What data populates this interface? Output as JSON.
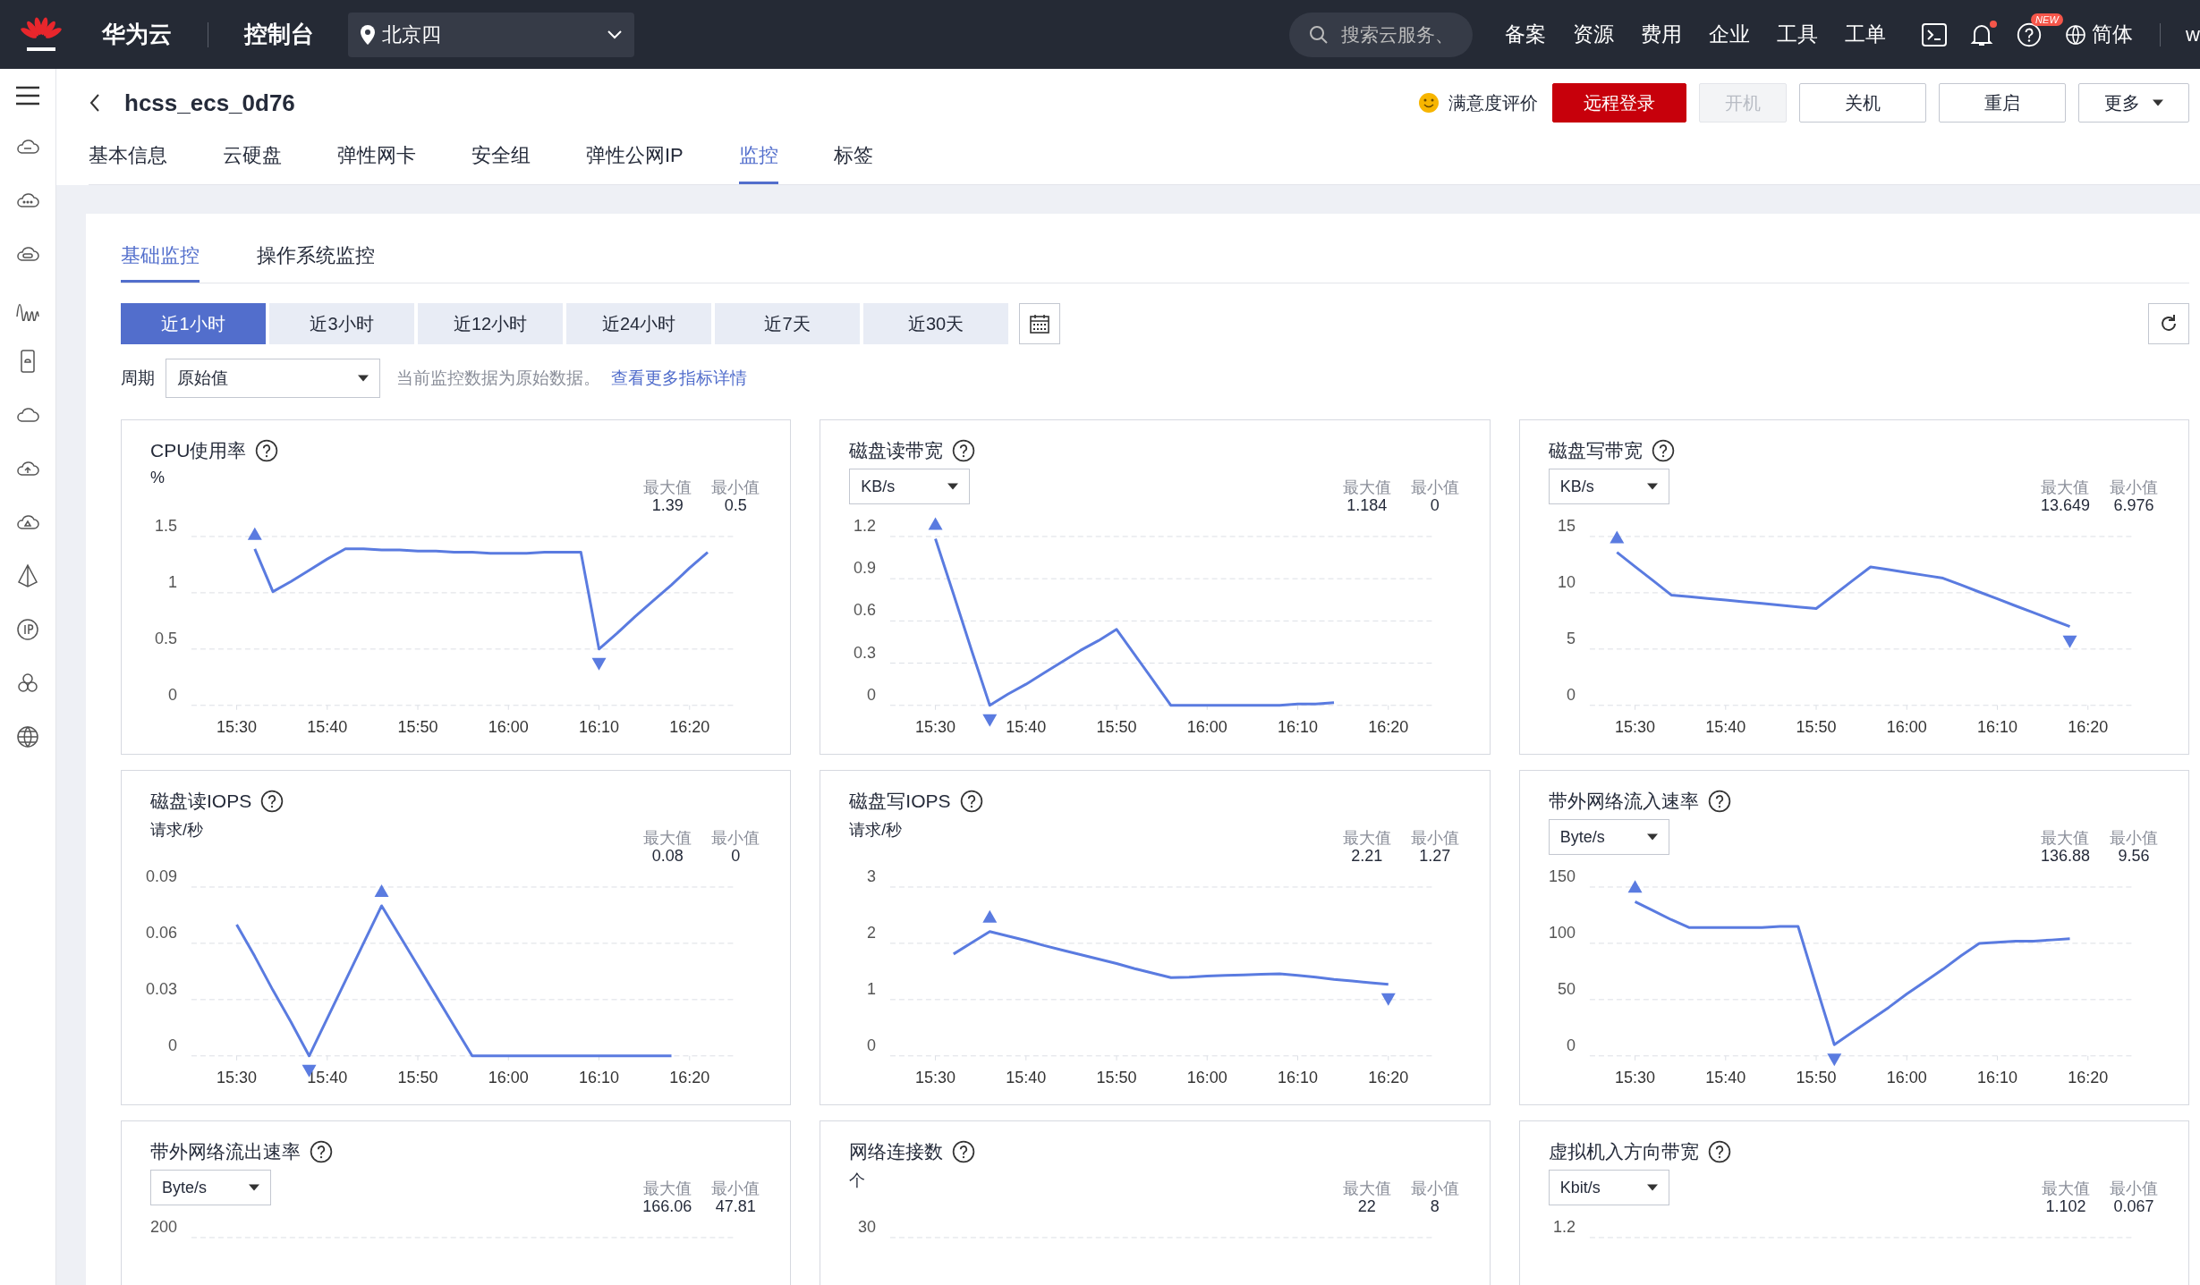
{
  "top_bar": {
    "brand": "华为云",
    "console": "控制台",
    "region": "北京四",
    "search": {
      "placeholder": "搜索云服务、"
    },
    "nav": [
      "备案",
      "资源",
      "费用",
      "企业",
      "工具",
      "工单"
    ],
    "help_badge": "NEW",
    "language": "简体",
    "user": "w"
  },
  "header": {
    "title": "hcss_ecs_0d76",
    "feedback": "满意度评价",
    "buttons": [
      {
        "label": "远程登录",
        "kind": "primary"
      },
      {
        "label": "开机",
        "kind": "disabled"
      },
      {
        "label": "关机",
        "kind": "default"
      },
      {
        "label": "重启",
        "kind": "default"
      },
      {
        "label": "更多",
        "kind": "dropdown"
      }
    ]
  },
  "tabs": [
    {
      "label": "基本信息",
      "selected": false
    },
    {
      "label": "云硬盘",
      "selected": false
    },
    {
      "label": "弹性网卡",
      "selected": false
    },
    {
      "label": "安全组",
      "selected": false
    },
    {
      "label": "弹性公网IP",
      "selected": false
    },
    {
      "label": "监控",
      "selected": true
    },
    {
      "label": "标签",
      "selected": false
    }
  ],
  "sub_tabs": [
    {
      "label": "基础监控",
      "selected": true
    },
    {
      "label": "操作系统监控",
      "selected": false
    }
  ],
  "time_ranges": [
    {
      "label": "近1小时",
      "selected": true
    },
    {
      "label": "近3小时",
      "selected": false
    },
    {
      "label": "近12小时",
      "selected": false
    },
    {
      "label": "近24小时",
      "selected": false
    },
    {
      "label": "近7天",
      "selected": false
    },
    {
      "label": "近30天",
      "selected": false
    }
  ],
  "period": {
    "label": "周期",
    "value": "原始值",
    "note": "当前监控数据为原始数据。",
    "link": "查看更多指标详情"
  },
  "charts": [
    {
      "title": "CPU使用率",
      "unit": "%",
      "stats": [
        {
          "label": "最大值",
          "value": "1.39"
        },
        {
          "label": "最小值",
          "value": "0.5"
        }
      ],
      "chart_data": {
        "type": "line",
        "grid": true,
        "ylim": [
          0,
          1.5
        ],
        "yticks": [
          0,
          0.5,
          1,
          1.5
        ],
        "categories": [
          null,
          null,
          "15:30",
          null,
          null,
          null,
          null,
          "15:40",
          null,
          null,
          null,
          null,
          "15:50",
          null,
          null,
          null,
          null,
          "16:00",
          null,
          null,
          null,
          null,
          "16:10",
          null,
          null,
          null,
          null,
          "16:20",
          null,
          null
        ],
        "series": [
          {
            "color": "#5a7be0",
            "values": [
              null,
              null,
              null,
              1.39,
              1.01,
              1.1,
              1.2,
              1.3,
              1.39,
              1.39,
              1.38,
              1.38,
              1.37,
              1.37,
              1.36,
              1.36,
              1.35,
              1.35,
              1.35,
              1.36,
              1.36,
              1.36,
              0.5,
              0.64,
              0.79,
              0.93,
              1.07,
              1.22,
              1.36,
              null
            ]
          }
        ]
      }
    },
    {
      "title": "磁盘读带宽",
      "unit_select": "KB/s",
      "stats": [
        {
          "label": "最大值",
          "value": "1.184"
        },
        {
          "label": "最小值",
          "value": "0"
        }
      ],
      "chart_data": {
        "type": "line",
        "grid": true,
        "ylim": [
          0,
          1.2
        ],
        "yticks": [
          0,
          0.3,
          0.6,
          0.9,
          1.2
        ],
        "categories": [
          null,
          null,
          "15:30",
          null,
          null,
          null,
          null,
          "15:40",
          null,
          null,
          null,
          null,
          "15:50",
          null,
          null,
          null,
          null,
          "16:00",
          null,
          null,
          null,
          null,
          "16:10",
          null,
          null,
          null,
          null,
          "16:20",
          null,
          null
        ],
        "series": [
          {
            "color": "#5a7be0",
            "values": [
              null,
              null,
              1.184,
              0.79,
              0.39,
              0,
              0.08,
              0.15,
              0.23,
              0.31,
              0.39,
              0.46,
              0.54,
              0.36,
              0.18,
              0,
              0,
              0,
              0,
              0,
              0,
              0,
              0.01,
              0.01,
              0.02,
              null,
              null,
              null,
              null,
              null
            ]
          }
        ]
      }
    },
    {
      "title": "磁盘写带宽",
      "unit_select": "KB/s",
      "stats": [
        {
          "label": "最大值",
          "value": "13.649"
        },
        {
          "label": "最小值",
          "value": "6.976"
        }
      ],
      "chart_data": {
        "type": "line",
        "grid": true,
        "ylim": [
          0,
          15
        ],
        "yticks": [
          0,
          5,
          10,
          15
        ],
        "categories": [
          null,
          null,
          "15:30",
          null,
          null,
          null,
          null,
          "15:40",
          null,
          null,
          null,
          null,
          "15:50",
          null,
          null,
          null,
          null,
          "16:00",
          null,
          null,
          null,
          null,
          "16:10",
          null,
          null,
          null,
          null,
          "16:20",
          null,
          null
        ],
        "series": [
          {
            "color": "#5a7be0",
            "values": [
              null,
              13.6,
              12.33,
              11.07,
              9.8,
              9.65,
              9.5,
              9.35,
              9.2,
              9.05,
              8.9,
              8.75,
              8.6,
              9.83,
              11.07,
              12.3,
              12.05,
              11.8,
              11.55,
              11.3,
              10.69,
              10.07,
              9.46,
              8.84,
              8.23,
              7.61,
              7.0,
              null,
              null,
              null
            ]
          }
        ]
      }
    },
    {
      "title": "磁盘读IOPS",
      "unit": "请求/秒",
      "stats": [
        {
          "label": "最大值",
          "value": "0.08"
        },
        {
          "label": "最小值",
          "value": "0"
        }
      ],
      "chart_data": {
        "type": "line",
        "grid": true,
        "ylim": [
          0,
          0.09
        ],
        "yticks": [
          0,
          0.03,
          0.06,
          0.09
        ],
        "categories": [
          null,
          null,
          "15:30",
          null,
          null,
          null,
          null,
          "15:40",
          null,
          null,
          null,
          null,
          "15:50",
          null,
          null,
          null,
          null,
          "16:00",
          null,
          null,
          null,
          null,
          "16:10",
          null,
          null,
          null,
          null,
          "16:20",
          null,
          null
        ],
        "series": [
          {
            "color": "#5a7be0",
            "values": [
              null,
              null,
              0.07,
              0.053,
              0.035,
              0.018,
              0,
              0.02,
              0.04,
              0.06,
              0.08,
              0.064,
              0.048,
              0.032,
              0.016,
              0,
              0,
              0,
              0,
              0,
              0,
              0,
              0,
              0,
              0,
              0,
              0,
              null,
              null,
              null
            ]
          }
        ]
      }
    },
    {
      "title": "磁盘写IOPS",
      "unit": "请求/秒",
      "stats": [
        {
          "label": "最大值",
          "value": "2.21"
        },
        {
          "label": "最小值",
          "value": "1.27"
        }
      ],
      "chart_data": {
        "type": "line",
        "grid": true,
        "ylim": [
          0,
          3
        ],
        "yticks": [
          0,
          1,
          2,
          3
        ],
        "categories": [
          null,
          null,
          "15:30",
          null,
          null,
          null,
          null,
          "15:40",
          null,
          null,
          null,
          null,
          "15:50",
          null,
          null,
          null,
          null,
          "16:00",
          null,
          null,
          null,
          null,
          "16:10",
          null,
          null,
          null,
          null,
          "16:20",
          null,
          null
        ],
        "series": [
          {
            "color": "#5a7be0",
            "values": [
              null,
              null,
              null,
              1.81,
              2.01,
              2.21,
              2.13,
              2.05,
              1.96,
              1.88,
              1.8,
              1.72,
              1.64,
              1.55,
              1.47,
              1.39,
              1.4,
              1.42,
              1.43,
              1.44,
              1.45,
              1.46,
              1.43,
              1.4,
              1.36,
              1.33,
              1.3,
              1.27,
              null,
              null
            ]
          }
        ]
      }
    },
    {
      "title": "带外网络流入速率",
      "unit_select": "Byte/s",
      "stats": [
        {
          "label": "最大值",
          "value": "136.88"
        },
        {
          "label": "最小值",
          "value": "9.56"
        }
      ],
      "chart_data": {
        "type": "line",
        "grid": true,
        "ylim": [
          0,
          150
        ],
        "yticks": [
          0,
          50,
          100,
          150
        ],
        "categories": [
          null,
          null,
          "15:30",
          null,
          null,
          null,
          null,
          "15:40",
          null,
          null,
          null,
          null,
          "15:50",
          null,
          null,
          null,
          null,
          "16:00",
          null,
          null,
          null,
          null,
          "16:10",
          null,
          null,
          null,
          null,
          "16:20",
          null,
          null
        ],
        "series": [
          {
            "color": "#5a7be0",
            "values": [
              null,
              null,
              137,
              129,
              121,
              114,
              114,
              114,
              114,
              114,
              115,
              115,
              62,
              10,
              21,
              32,
              43,
              55,
              66,
              77,
              89,
              100,
              101,
              102,
              102,
              103,
              104,
              null,
              null,
              null
            ]
          }
        ]
      }
    }
  ],
  "partial_charts": [
    {
      "title": "带外网络流出速率",
      "unit_select": "Byte/s",
      "stats": [
        {
          "label": "最大值",
          "value": "166.06"
        },
        {
          "label": "最小值",
          "value": "47.81"
        }
      ],
      "top_tick": "200"
    },
    {
      "title": "网络连接数",
      "unit": "个",
      "stats": [
        {
          "label": "最大值",
          "value": "22"
        },
        {
          "label": "最小值",
          "value": "8"
        }
      ],
      "top_tick": "30"
    },
    {
      "title": "虚拟机入方向带宽",
      "unit_select": "Kbit/s",
      "stats": [
        {
          "label": "最大值",
          "value": "1.102"
        },
        {
          "label": "最小值",
          "value": "0.067"
        }
      ],
      "top_tick": "1.2"
    }
  ]
}
